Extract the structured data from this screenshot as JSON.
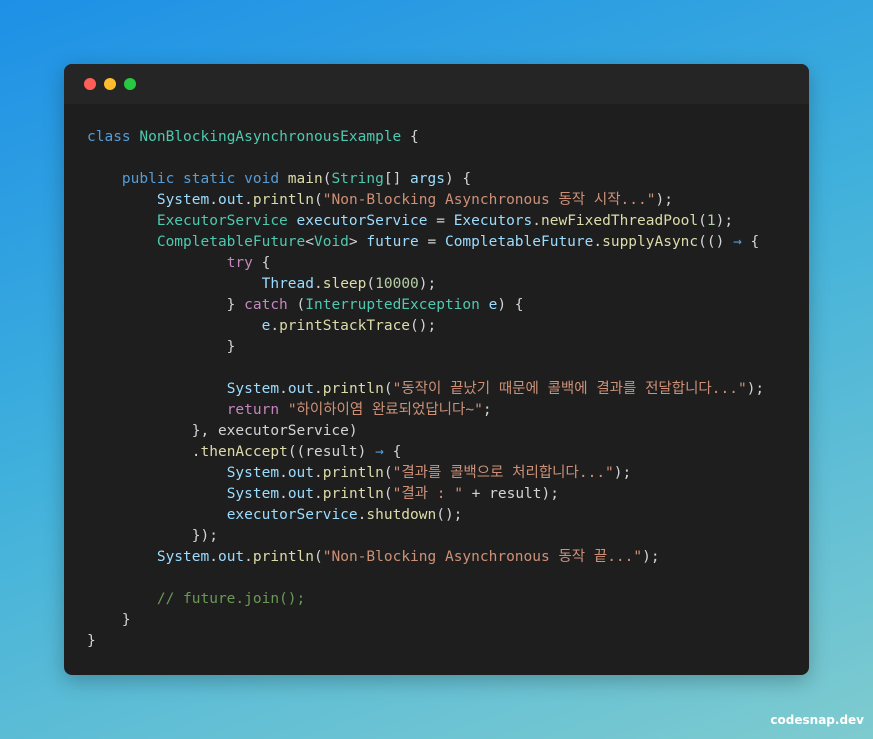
{
  "window": {
    "controls": [
      {
        "name": "close",
        "color": "#ff5f57"
      },
      {
        "name": "minimize",
        "color": "#febc2e"
      },
      {
        "name": "maximize",
        "color": "#28c840"
      }
    ]
  },
  "code": {
    "lines": [
      [
        {
          "t": "kw",
          "v": "class "
        },
        {
          "t": "cls",
          "v": "NonBlockingAsynchronousExample"
        },
        {
          "t": "op",
          "v": " {"
        }
      ],
      [],
      [
        {
          "t": "op",
          "v": "    "
        },
        {
          "t": "kw",
          "v": "public static void "
        },
        {
          "t": "fn",
          "v": "main"
        },
        {
          "t": "op",
          "v": "("
        },
        {
          "t": "cls",
          "v": "String"
        },
        {
          "t": "op",
          "v": "[] "
        },
        {
          "t": "var",
          "v": "args"
        },
        {
          "t": "op",
          "v": ") {"
        }
      ],
      [
        {
          "t": "op",
          "v": "        "
        },
        {
          "t": "var",
          "v": "System"
        },
        {
          "t": "op",
          "v": "."
        },
        {
          "t": "var",
          "v": "out"
        },
        {
          "t": "op",
          "v": "."
        },
        {
          "t": "fn",
          "v": "println"
        },
        {
          "t": "op",
          "v": "("
        },
        {
          "t": "str",
          "v": "\"Non-Blocking Asynchronous 동작 시작...\""
        },
        {
          "t": "op",
          "v": ");"
        }
      ],
      [
        {
          "t": "op",
          "v": "        "
        },
        {
          "t": "cls",
          "v": "ExecutorService"
        },
        {
          "t": "op",
          "v": " "
        },
        {
          "t": "var",
          "v": "executorService"
        },
        {
          "t": "op",
          "v": " = "
        },
        {
          "t": "var",
          "v": "Executors"
        },
        {
          "t": "op",
          "v": "."
        },
        {
          "t": "fn",
          "v": "newFixedThreadPool"
        },
        {
          "t": "op",
          "v": "("
        },
        {
          "t": "num",
          "v": "1"
        },
        {
          "t": "op",
          "v": ");"
        }
      ],
      [
        {
          "t": "op",
          "v": "        "
        },
        {
          "t": "cls",
          "v": "CompletableFuture"
        },
        {
          "t": "op",
          "v": "<"
        },
        {
          "t": "cls",
          "v": "Void"
        },
        {
          "t": "op",
          "v": "> "
        },
        {
          "t": "var",
          "v": "future"
        },
        {
          "t": "op",
          "v": " = "
        },
        {
          "t": "var",
          "v": "CompletableFuture"
        },
        {
          "t": "op",
          "v": "."
        },
        {
          "t": "fn",
          "v": "supplyAsync"
        },
        {
          "t": "op",
          "v": "(() "
        },
        {
          "t": "arrow",
          "v": "→"
        },
        {
          "t": "op",
          "v": " {"
        }
      ],
      [
        {
          "t": "op",
          "v": "                "
        },
        {
          "t": "kw2",
          "v": "try"
        },
        {
          "t": "op",
          "v": " {"
        }
      ],
      [
        {
          "t": "op",
          "v": "                    "
        },
        {
          "t": "var",
          "v": "Thread"
        },
        {
          "t": "op",
          "v": "."
        },
        {
          "t": "fn",
          "v": "sleep"
        },
        {
          "t": "op",
          "v": "("
        },
        {
          "t": "num",
          "v": "10000"
        },
        {
          "t": "op",
          "v": ");"
        }
      ],
      [
        {
          "t": "op",
          "v": "                } "
        },
        {
          "t": "kw2",
          "v": "catch"
        },
        {
          "t": "op",
          "v": " ("
        },
        {
          "t": "cls",
          "v": "InterruptedException"
        },
        {
          "t": "op",
          "v": " "
        },
        {
          "t": "var",
          "v": "e"
        },
        {
          "t": "op",
          "v": ") {"
        }
      ],
      [
        {
          "t": "op",
          "v": "                    "
        },
        {
          "t": "var",
          "v": "e"
        },
        {
          "t": "op",
          "v": "."
        },
        {
          "t": "fn",
          "v": "printStackTrace"
        },
        {
          "t": "op",
          "v": "();"
        }
      ],
      [
        {
          "t": "op",
          "v": "                }"
        }
      ],
      [],
      [
        {
          "t": "op",
          "v": "                "
        },
        {
          "t": "var",
          "v": "System"
        },
        {
          "t": "op",
          "v": "."
        },
        {
          "t": "var",
          "v": "out"
        },
        {
          "t": "op",
          "v": "."
        },
        {
          "t": "fn",
          "v": "println"
        },
        {
          "t": "op",
          "v": "("
        },
        {
          "t": "str",
          "v": "\"동작이 끝났기 때문에 콜백에 결과를 전달합니다...\""
        },
        {
          "t": "op",
          "v": ");"
        }
      ],
      [
        {
          "t": "op",
          "v": "                "
        },
        {
          "t": "kw2",
          "v": "return"
        },
        {
          "t": "op",
          "v": " "
        },
        {
          "t": "str",
          "v": "\"하이하이염 완료되었답니다~\""
        },
        {
          "t": "op",
          "v": ";"
        }
      ],
      [
        {
          "t": "op",
          "v": "            }, executorService)"
        }
      ],
      [
        {
          "t": "op",
          "v": "            ."
        },
        {
          "t": "fn",
          "v": "thenAccept"
        },
        {
          "t": "op",
          "v": "((result) "
        },
        {
          "t": "arrow",
          "v": "→"
        },
        {
          "t": "op",
          "v": " {"
        }
      ],
      [
        {
          "t": "op",
          "v": "                "
        },
        {
          "t": "var",
          "v": "System"
        },
        {
          "t": "op",
          "v": "."
        },
        {
          "t": "var",
          "v": "out"
        },
        {
          "t": "op",
          "v": "."
        },
        {
          "t": "fn",
          "v": "println"
        },
        {
          "t": "op",
          "v": "("
        },
        {
          "t": "str",
          "v": "\"결과를 콜백으로 처리합니다...\""
        },
        {
          "t": "op",
          "v": ");"
        }
      ],
      [
        {
          "t": "op",
          "v": "                "
        },
        {
          "t": "var",
          "v": "System"
        },
        {
          "t": "op",
          "v": "."
        },
        {
          "t": "var",
          "v": "out"
        },
        {
          "t": "op",
          "v": "."
        },
        {
          "t": "fn",
          "v": "println"
        },
        {
          "t": "op",
          "v": "("
        },
        {
          "t": "str",
          "v": "\"결과 : \""
        },
        {
          "t": "op",
          "v": " + result);"
        }
      ],
      [
        {
          "t": "op",
          "v": "                "
        },
        {
          "t": "var",
          "v": "executorService"
        },
        {
          "t": "op",
          "v": "."
        },
        {
          "t": "fn",
          "v": "shutdown"
        },
        {
          "t": "op",
          "v": "();"
        }
      ],
      [
        {
          "t": "op",
          "v": "            });"
        }
      ],
      [
        {
          "t": "op",
          "v": "        "
        },
        {
          "t": "var",
          "v": "System"
        },
        {
          "t": "op",
          "v": "."
        },
        {
          "t": "var",
          "v": "out"
        },
        {
          "t": "op",
          "v": "."
        },
        {
          "t": "fn",
          "v": "println"
        },
        {
          "t": "op",
          "v": "("
        },
        {
          "t": "str",
          "v": "\"Non-Blocking Asynchronous 동작 끝...\""
        },
        {
          "t": "op",
          "v": ");"
        }
      ],
      [],
      [
        {
          "t": "op",
          "v": "        "
        },
        {
          "t": "cmt",
          "v": "// future.join();"
        }
      ],
      [
        {
          "t": "op",
          "v": "    }"
        }
      ],
      [
        {
          "t": "op",
          "v": "}"
        }
      ]
    ]
  },
  "watermark": "codesnap.dev"
}
